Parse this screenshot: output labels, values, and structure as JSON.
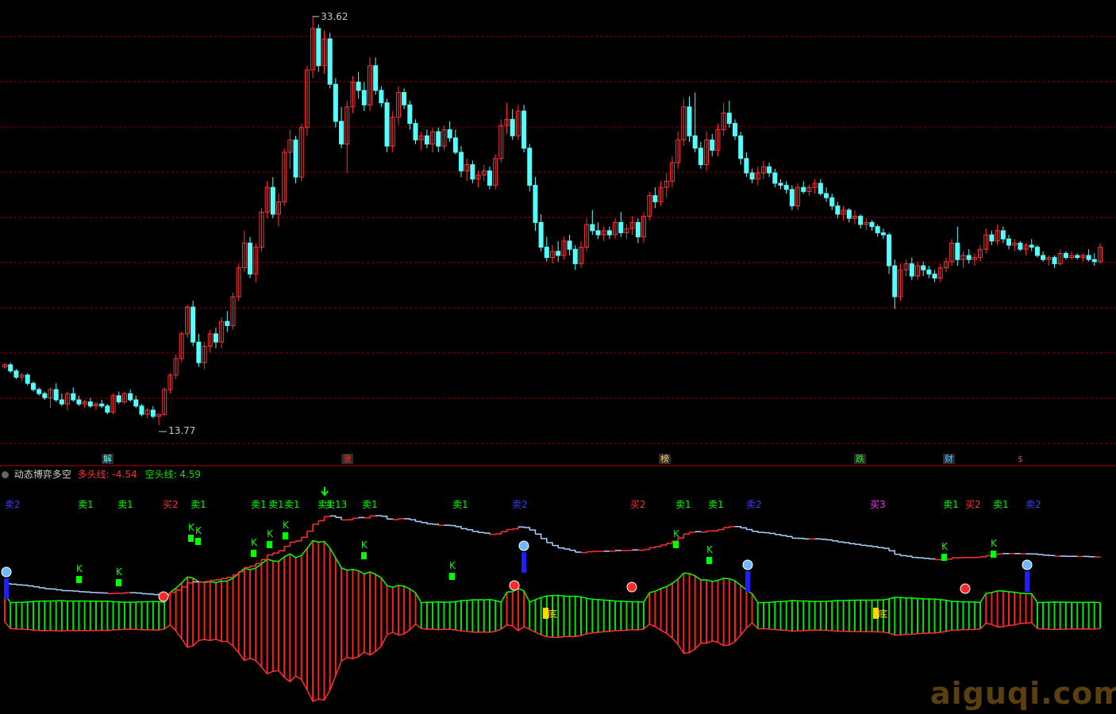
{
  "indicator": {
    "name": "动态博弈多空",
    "bull_label": "多头线:",
    "bull_value": "-4.54",
    "bear_label": "空头线:",
    "bear_value": "4.59"
  },
  "colors": {
    "up": "#ff3232",
    "down": "#54ffff",
    "grid": "#8b0000",
    "green": "#00e600",
    "red": "#ff1e1e",
    "blue_line": "#aad4ff"
  },
  "price_markers": {
    "high": "33.62",
    "low": "13.77"
  },
  "event_tags": [
    {
      "text": "解",
      "color": "#54ffff",
      "bg": "#2a2a2a"
    },
    {
      "text": "涨",
      "color": "#ff3232",
      "bg": "#2a2a2a"
    },
    {
      "text": "榜",
      "color": "#ffcc66",
      "bg": "#2a2a2a"
    },
    {
      "text": "跌",
      "color": "#00ff00",
      "bg": "#2a2a2a"
    },
    {
      "text": "财",
      "color": "#54c8ff",
      "bg": "#2a2a2a"
    },
    {
      "text": "$",
      "color": "#ff3232",
      "bg": "#000"
    }
  ],
  "signals": [
    {
      "text": "卖2",
      "color": "#3c3cff"
    },
    {
      "text": "卖1",
      "color": "#00ff00"
    },
    {
      "text": "卖1",
      "color": "#00ff00"
    },
    {
      "text": "买2",
      "color": "#ff3232"
    },
    {
      "text": "卖1",
      "color": "#00ff00"
    },
    {
      "text": "卖1",
      "color": "#00ff00"
    },
    {
      "text": "卖1",
      "color": "#00ff00"
    },
    {
      "text": "卖1",
      "color": "#00ff00"
    },
    {
      "text": "卖1",
      "color": "#00ff00"
    },
    {
      "text": "卖13",
      "color": "#00ff00"
    },
    {
      "text": "卖1",
      "color": "#00ff00"
    },
    {
      "text": "卖1",
      "color": "#00ff00"
    },
    {
      "text": "卖2",
      "color": "#3c3cff"
    },
    {
      "text": "买2",
      "color": "#ff3232"
    },
    {
      "text": "卖1",
      "color": "#00ff00"
    },
    {
      "text": "卖1",
      "color": "#00ff00"
    },
    {
      "text": "卖2",
      "color": "#3c3cff"
    },
    {
      "text": "买3",
      "color": "#ff32ff"
    },
    {
      "text": "卖1",
      "color": "#00ff00"
    },
    {
      "text": "买2",
      "color": "#ff3232"
    },
    {
      "text": "卖1",
      "color": "#00ff00"
    },
    {
      "text": "卖2",
      "color": "#3c3cff"
    }
  ],
  "k_labels": [
    "K",
    "K",
    "K",
    "K",
    "K",
    "K",
    "K",
    "K",
    "K",
    "K",
    "K",
    "K",
    "K"
  ],
  "bottom_labels": [
    "底",
    "底"
  ],
  "watermark": "aiguqi.com",
  "chart_data": {
    "type": "candlestick",
    "price_range": [
      13.0,
      34.0
    ],
    "grid": true,
    "candles": [
      [
        16.6,
        16.8,
        16.5,
        16.7
      ],
      [
        16.7,
        16.8,
        16.3,
        16.4
      ],
      [
        16.4,
        16.5,
        16.0,
        16.1
      ],
      [
        16.1,
        16.3,
        15.9,
        16.2
      ],
      [
        16.2,
        16.3,
        15.7,
        15.8
      ],
      [
        15.8,
        15.9,
        15.4,
        15.5
      ],
      [
        15.5,
        15.6,
        15.2,
        15.3
      ],
      [
        15.3,
        15.4,
        15.0,
        15.1
      ],
      [
        15.1,
        15.6,
        14.6,
        15.5
      ],
      [
        15.5,
        15.8,
        14.9,
        15.0
      ],
      [
        15.0,
        15.3,
        14.7,
        14.8
      ],
      [
        14.8,
        15.4,
        14.5,
        15.3
      ],
      [
        15.3,
        15.6,
        14.9,
        15.0
      ],
      [
        15.0,
        15.2,
        14.7,
        14.8
      ],
      [
        14.8,
        15.0,
        14.6,
        14.9
      ],
      [
        14.9,
        15.1,
        14.6,
        14.7
      ],
      [
        14.7,
        14.9,
        14.5,
        14.8
      ],
      [
        14.8,
        15.0,
        14.6,
        14.7
      ],
      [
        14.7,
        14.8,
        14.3,
        14.4
      ],
      [
        14.4,
        15.3,
        14.3,
        15.2
      ],
      [
        15.2,
        15.4,
        14.8,
        14.9
      ],
      [
        14.9,
        15.4,
        14.8,
        15.3
      ],
      [
        15.3,
        15.5,
        14.9,
        15.0
      ],
      [
        15.0,
        15.2,
        14.6,
        14.7
      ],
      [
        14.7,
        14.8,
        14.2,
        14.3
      ],
      [
        14.3,
        14.6,
        14.1,
        14.5
      ],
      [
        14.5,
        14.7,
        14.1,
        14.2
      ],
      [
        14.2,
        14.3,
        13.77,
        14.3
      ],
      [
        14.3,
        15.6,
        14.2,
        15.5
      ],
      [
        15.5,
        16.3,
        15.3,
        16.2
      ],
      [
        16.2,
        17.2,
        16.0,
        17.0
      ],
      [
        17.0,
        18.3,
        16.8,
        18.2
      ],
      [
        18.2,
        19.6,
        18.0,
        19.5
      ],
      [
        19.5,
        19.8,
        17.6,
        17.8
      ],
      [
        17.8,
        18.2,
        16.6,
        16.8
      ],
      [
        16.8,
        17.8,
        16.5,
        17.6
      ],
      [
        17.6,
        18.4,
        17.3,
        18.2
      ],
      [
        18.2,
        18.5,
        17.5,
        17.8
      ],
      [
        17.8,
        19.0,
        17.5,
        18.8
      ],
      [
        18.8,
        19.3,
        18.3,
        18.6
      ],
      [
        18.6,
        20.2,
        18.4,
        20.0
      ],
      [
        20.0,
        21.6,
        19.8,
        21.4
      ],
      [
        21.4,
        23.2,
        21.2,
        22.6
      ],
      [
        22.6,
        22.9,
        20.9,
        21.1
      ],
      [
        21.1,
        22.6,
        20.7,
        22.4
      ],
      [
        22.4,
        24.3,
        22.2,
        24.1
      ],
      [
        24.1,
        25.6,
        23.8,
        25.3
      ],
      [
        25.3,
        25.8,
        23.8,
        24.0
      ],
      [
        24.0,
        25.0,
        23.4,
        24.6
      ],
      [
        24.6,
        27.2,
        24.4,
        27.0
      ],
      [
        27.0,
        28.1,
        26.2,
        27.6
      ],
      [
        27.6,
        27.8,
        25.5,
        25.8
      ],
      [
        25.8,
        28.4,
        25.6,
        28.2
      ],
      [
        28.2,
        31.2,
        27.8,
        31.0
      ],
      [
        31.0,
        33.62,
        30.6,
        33.0
      ],
      [
        33.0,
        33.2,
        30.9,
        31.2
      ],
      [
        31.2,
        32.9,
        30.8,
        32.5
      ],
      [
        32.5,
        32.8,
        30.1,
        30.3
      ],
      [
        30.3,
        30.6,
        28.2,
        28.5
      ],
      [
        28.5,
        29.2,
        27.2,
        27.4
      ],
      [
        27.4,
        29.5,
        26.0,
        29.2
      ],
      [
        29.2,
        30.7,
        28.9,
        30.4
      ],
      [
        30.4,
        30.9,
        29.6,
        30.0
      ],
      [
        30.0,
        30.4,
        29.0,
        29.3
      ],
      [
        29.3,
        31.6,
        29.0,
        31.2
      ],
      [
        31.2,
        31.6,
        29.8,
        30.0
      ],
      [
        30.0,
        30.2,
        29.2,
        29.4
      ],
      [
        29.4,
        29.6,
        27.0,
        27.3
      ],
      [
        27.3,
        29.0,
        27.0,
        28.7
      ],
      [
        28.7,
        30.2,
        28.3,
        29.9
      ],
      [
        29.9,
        30.1,
        29.1,
        29.3
      ],
      [
        29.3,
        29.5,
        28.1,
        28.4
      ],
      [
        28.4,
        28.6,
        27.4,
        27.6
      ],
      [
        27.6,
        28.0,
        27.1,
        27.8
      ],
      [
        27.8,
        28.1,
        27.2,
        27.4
      ],
      [
        27.4,
        28.2,
        27.0,
        28.0
      ],
      [
        28.0,
        28.2,
        27.0,
        27.3
      ],
      [
        27.3,
        28.3,
        27.1,
        28.1
      ],
      [
        28.1,
        28.5,
        27.5,
        27.7
      ],
      [
        27.7,
        28.1,
        26.9,
        27.0
      ],
      [
        27.0,
        27.3,
        25.8,
        26.1
      ],
      [
        26.1,
        26.7,
        25.6,
        26.4
      ],
      [
        26.4,
        26.6,
        25.5,
        25.7
      ],
      [
        25.7,
        26.1,
        25.3,
        25.9
      ],
      [
        25.9,
        26.4,
        25.6,
        26.1
      ],
      [
        26.1,
        26.3,
        25.2,
        25.4
      ],
      [
        25.4,
        26.9,
        25.2,
        26.7
      ],
      [
        26.7,
        28.6,
        26.5,
        28.3
      ],
      [
        28.3,
        29.4,
        27.9,
        28.6
      ],
      [
        28.6,
        29.1,
        27.6,
        27.8
      ],
      [
        27.8,
        29.3,
        27.6,
        29.0
      ],
      [
        29.0,
        29.3,
        27.0,
        27.2
      ],
      [
        27.2,
        27.4,
        25.1,
        25.4
      ],
      [
        25.4,
        25.8,
        23.2,
        23.6
      ],
      [
        23.6,
        24.0,
        22.2,
        22.4
      ],
      [
        22.4,
        22.9,
        21.7,
        21.9
      ],
      [
        21.9,
        22.5,
        21.6,
        22.2
      ],
      [
        22.2,
        22.7,
        21.7,
        22.0
      ],
      [
        22.0,
        22.9,
        21.8,
        22.7
      ],
      [
        22.7,
        23.0,
        22.0,
        22.3
      ],
      [
        22.3,
        22.5,
        21.3,
        21.6
      ],
      [
        21.6,
        22.7,
        21.4,
        22.4
      ],
      [
        22.4,
        23.8,
        22.2,
        23.5
      ],
      [
        23.5,
        24.2,
        23.0,
        23.2
      ],
      [
        23.2,
        23.6,
        22.8,
        23.0
      ],
      [
        23.0,
        23.4,
        22.7,
        23.2
      ],
      [
        23.2,
        23.4,
        22.8,
        23.0
      ],
      [
        23.0,
        23.8,
        22.8,
        23.6
      ],
      [
        23.6,
        24.1,
        22.9,
        23.1
      ],
      [
        23.1,
        23.5,
        22.8,
        23.3
      ],
      [
        23.3,
        23.9,
        23.0,
        23.6
      ],
      [
        23.6,
        23.8,
        22.6,
        22.9
      ],
      [
        22.9,
        24.1,
        22.6,
        23.9
      ],
      [
        23.9,
        25.1,
        23.7,
        24.9
      ],
      [
        24.9,
        25.3,
        24.3,
        24.6
      ],
      [
        24.6,
        25.6,
        24.4,
        25.3
      ],
      [
        25.3,
        26.0,
        24.8,
        25.6
      ],
      [
        25.6,
        26.8,
        25.3,
        26.5
      ],
      [
        26.5,
        28.0,
        26.2,
        27.6
      ],
      [
        27.6,
        29.6,
        27.3,
        29.2
      ],
      [
        29.2,
        29.7,
        27.5,
        27.8
      ],
      [
        27.8,
        29.9,
        27.0,
        27.2
      ],
      [
        27.2,
        27.5,
        26.2,
        26.4
      ],
      [
        26.4,
        28.0,
        26.1,
        27.6
      ],
      [
        27.6,
        27.9,
        26.8,
        27.1
      ],
      [
        27.1,
        28.4,
        26.8,
        28.1
      ],
      [
        28.1,
        29.4,
        27.8,
        28.9
      ],
      [
        28.9,
        29.5,
        28.2,
        28.4
      ],
      [
        28.4,
        28.6,
        27.6,
        27.8
      ],
      [
        27.8,
        28.0,
        26.4,
        26.7
      ],
      [
        26.7,
        27.0,
        25.8,
        26.0
      ],
      [
        26.0,
        26.2,
        25.5,
        25.7
      ],
      [
        25.7,
        26.3,
        25.4,
        26.0
      ],
      [
        26.0,
        26.6,
        25.7,
        26.3
      ],
      [
        26.3,
        26.5,
        25.8,
        26.0
      ],
      [
        26.0,
        26.2,
        25.3,
        25.5
      ],
      [
        25.5,
        25.7,
        25.2,
        25.4
      ],
      [
        25.4,
        25.6,
        25.0,
        25.2
      ],
      [
        25.2,
        25.4,
        24.2,
        24.4
      ],
      [
        24.4,
        25.5,
        24.2,
        25.3
      ],
      [
        25.3,
        25.6,
        25.0,
        25.1
      ],
      [
        25.1,
        25.4,
        24.9,
        25.3
      ],
      [
        25.3,
        25.7,
        25.0,
        25.5
      ],
      [
        25.5,
        25.7,
        24.9,
        25.0
      ],
      [
        25.0,
        25.3,
        24.6,
        24.8
      ],
      [
        24.8,
        25.0,
        24.2,
        24.4
      ],
      [
        24.4,
        24.6,
        23.8,
        24.0
      ],
      [
        24.0,
        24.4,
        23.7,
        24.2
      ],
      [
        24.2,
        24.3,
        23.6,
        23.8
      ],
      [
        23.8,
        24.2,
        23.5,
        23.9
      ],
      [
        23.9,
        24.0,
        23.3,
        23.5
      ],
      [
        23.5,
        23.8,
        23.2,
        23.6
      ],
      [
        23.6,
        23.7,
        23.2,
        23.4
      ],
      [
        23.4,
        23.5,
        22.9,
        23.1
      ],
      [
        23.1,
        23.3,
        22.8,
        23.0
      ],
      [
        23.0,
        23.1,
        21.1,
        21.5
      ],
      [
        21.5,
        21.8,
        19.4,
        20.0
      ],
      [
        20.0,
        21.6,
        19.8,
        21.3
      ],
      [
        21.3,
        21.8,
        21.0,
        21.6
      ],
      [
        21.6,
        21.9,
        20.8,
        21.0
      ],
      [
        21.0,
        21.7,
        20.8,
        21.5
      ],
      [
        21.5,
        21.7,
        21.0,
        21.3
      ],
      [
        21.3,
        21.5,
        20.9,
        21.1
      ],
      [
        21.1,
        21.3,
        20.7,
        20.9
      ],
      [
        20.9,
        21.6,
        20.7,
        21.4
      ],
      [
        21.4,
        21.9,
        21.2,
        21.7
      ],
      [
        21.7,
        22.8,
        21.5,
        22.6
      ],
      [
        22.6,
        23.4,
        21.5,
        21.8
      ],
      [
        21.8,
        22.2,
        21.4,
        22.0
      ],
      [
        22.0,
        22.3,
        21.6,
        21.8
      ],
      [
        21.8,
        22.1,
        21.5,
        21.9
      ],
      [
        21.9,
        22.5,
        21.7,
        22.3
      ],
      [
        22.3,
        23.3,
        22.1,
        23.0
      ],
      [
        23.0,
        23.2,
        22.5,
        22.7
      ],
      [
        22.7,
        23.5,
        22.5,
        23.2
      ],
      [
        23.2,
        23.4,
        22.6,
        22.8
      ],
      [
        22.8,
        23.0,
        22.3,
        22.5
      ],
      [
        22.5,
        22.8,
        22.2,
        22.6
      ],
      [
        22.6,
        22.7,
        22.2,
        22.3
      ],
      [
        22.3,
        22.6,
        22.0,
        22.5
      ],
      [
        22.5,
        22.8,
        22.2,
        22.4
      ],
      [
        22.4,
        22.5,
        21.9,
        22.0
      ],
      [
        22.0,
        22.2,
        21.7,
        21.8
      ],
      [
        21.8,
        22.0,
        21.5,
        21.9
      ],
      [
        21.9,
        22.0,
        21.4,
        21.6
      ],
      [
        21.6,
        22.3,
        21.5,
        22.1
      ],
      [
        22.1,
        22.2,
        21.8,
        21.9
      ],
      [
        21.9,
        22.2,
        21.8,
        22.0
      ],
      [
        22.0,
        22.1,
        21.8,
        21.9
      ],
      [
        21.9,
        22.1,
        21.7,
        22.0
      ],
      [
        22.0,
        22.3,
        21.7,
        21.8
      ],
      [
        21.8,
        22.1,
        21.5,
        21.7
      ],
      [
        21.7,
        22.6,
        21.6,
        22.4
      ]
    ],
    "indicator_area": [],
    "note": ""
  }
}
